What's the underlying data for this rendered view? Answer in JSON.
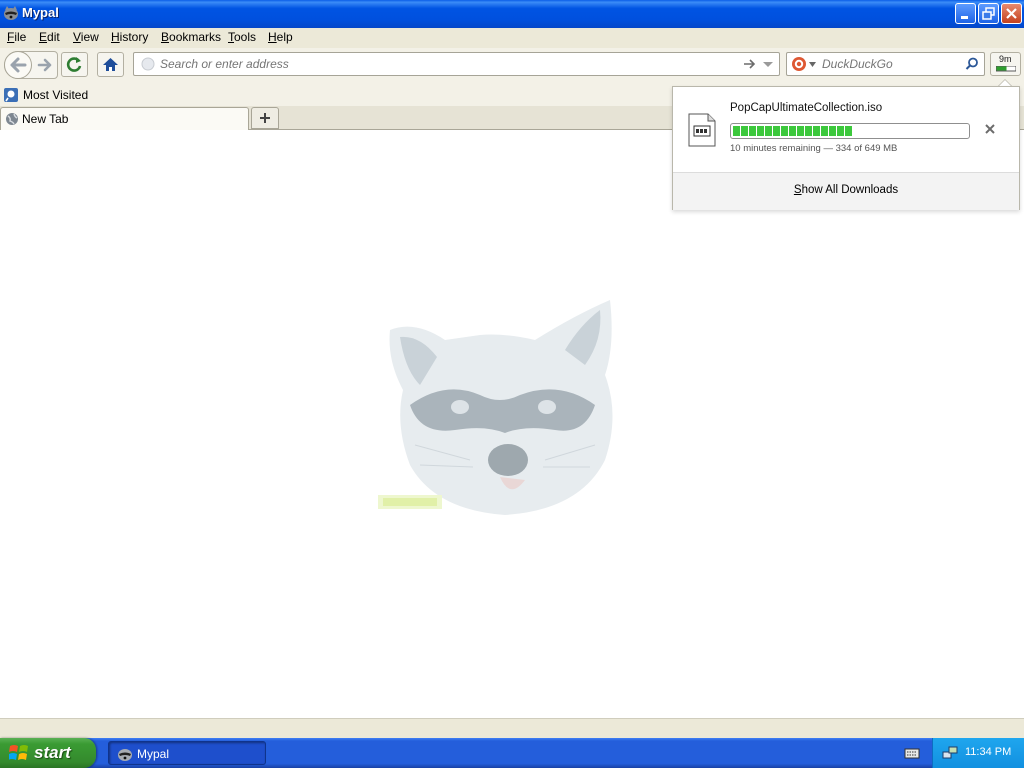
{
  "window": {
    "title": "Mypal"
  },
  "menu": {
    "items": [
      {
        "label": "File",
        "key": "F",
        "rest": "ile"
      },
      {
        "label": "Edit",
        "key": "E",
        "rest": "dit"
      },
      {
        "label": "View",
        "key": "V",
        "rest": "iew"
      },
      {
        "label": "History",
        "key": "H",
        "rest": "istory"
      },
      {
        "label": "Bookmarks",
        "key": "B",
        "rest": "ookmarks"
      },
      {
        "label": "Tools",
        "key": "T",
        "rest": "ools"
      },
      {
        "label": "Help",
        "key": "H",
        "rest": "elp"
      }
    ]
  },
  "navbar": {
    "address_placeholder": "Search or enter address",
    "search_engine": "DuckDuckGo",
    "downloads_time": "9m"
  },
  "bookmarks": {
    "items": [
      {
        "label": "Most Visited"
      }
    ]
  },
  "tabs": {
    "items": [
      {
        "label": "New Tab"
      }
    ]
  },
  "downloads_panel": {
    "filename": "PopCapUltimateCollection.iso",
    "status": "10 minutes remaining — 334 of 649 MB",
    "progress_fraction": 0.515,
    "show_all_label": "Show All Downloads",
    "show_all_key": "S",
    "show_all_rest": "how All Downloads"
  },
  "taskbar": {
    "start_label": "start",
    "task_label": "Mypal",
    "clock": "11:34 PM"
  },
  "colors": {
    "titlebar": "#0054e3",
    "progress": "#3cc83c",
    "taskbar": "#245edb",
    "start": "#3a9b33"
  }
}
